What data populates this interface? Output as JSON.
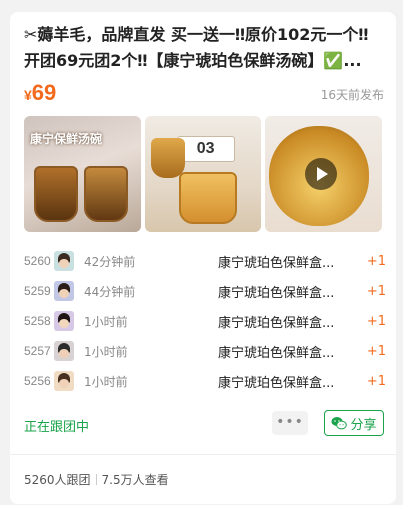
{
  "post": {
    "title": "✂薅羊毛，品牌直发 买一送一‼原价102元一个‼开团69元团2个‼【康宁琥珀色保鲜汤碗】✅...",
    "price_symbol": "¥",
    "price": "69",
    "posted": "16天前发布"
  },
  "images": {
    "caption": "康宁保鲜汤碗",
    "calendar": "03",
    "video_icon": "play-icon"
  },
  "orders": [
    {
      "seq": "5260",
      "time": "42分钟前",
      "item": "康宁琥珀色保鲜盒...",
      "qty": "+1",
      "avatar_color": "#c9dfe0"
    },
    {
      "seq": "5259",
      "time": "44分钟前",
      "item": "康宁琥珀色保鲜盒...",
      "qty": "+1",
      "avatar_color": "#c3c7e6"
    },
    {
      "seq": "5258",
      "time": "1小时前",
      "item": "康宁琥珀色保鲜盒...",
      "qty": "+1",
      "avatar_color": "#d7c9e6"
    },
    {
      "seq": "5257",
      "time": "1小时前",
      "item": "康宁琥珀色保鲜盒...",
      "qty": "+1",
      "avatar_color": "#d9d2d2"
    },
    {
      "seq": "5256",
      "time": "1小时前",
      "item": "康宁琥珀色保鲜盒...",
      "qty": "+1",
      "avatar_color": "#f0dcc2"
    }
  ],
  "actions": {
    "status": "正在跟团中",
    "more": "•••",
    "share": "分享"
  },
  "footer": {
    "joined": "5260人跟团",
    "views": "7.5万人查看"
  },
  "colors": {
    "accent_orange": "#f26b1d",
    "accent_green": "#1aa34a"
  }
}
